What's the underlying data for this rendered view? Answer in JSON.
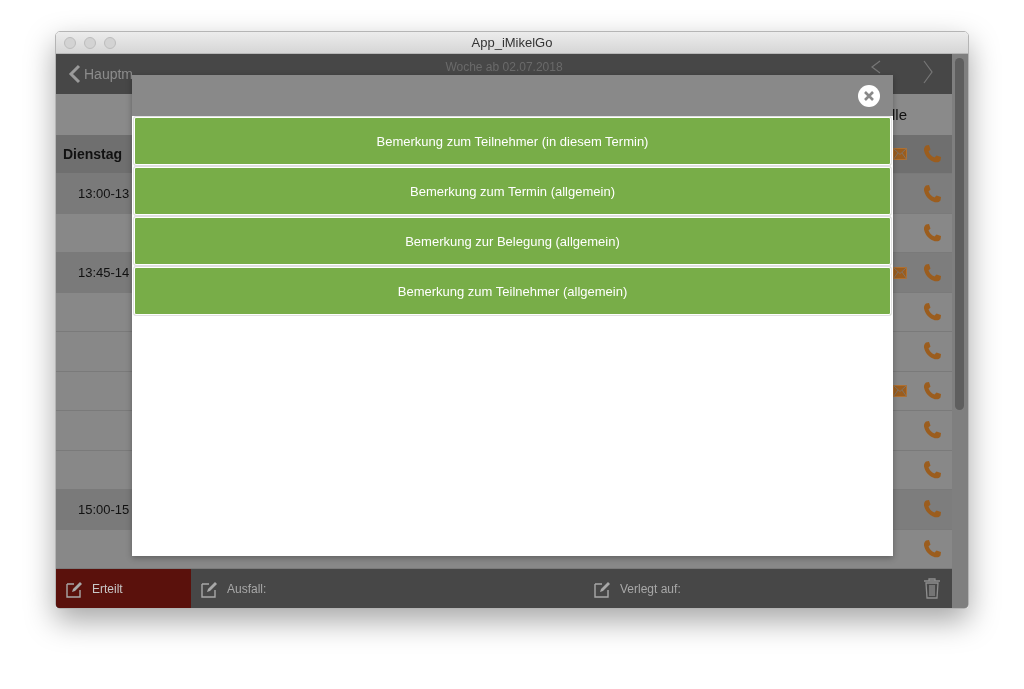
{
  "window": {
    "title": "App_iMikelGo"
  },
  "header": {
    "back_label": "Hauptm",
    "title": "Woche ab 02.07.2018"
  },
  "column_header": "lle",
  "rows": [
    {
      "kind": "day",
      "label": "Dienstag",
      "mail": true
    },
    {
      "kind": "time",
      "label": "13:00-13",
      "mail": false
    },
    {
      "kind": "empty",
      "mail": false
    },
    {
      "kind": "time",
      "label": "13:45-14",
      "mail": true
    },
    {
      "kind": "empty",
      "mail": false
    },
    {
      "kind": "empty",
      "mail": false
    },
    {
      "kind": "empty",
      "mail": true
    },
    {
      "kind": "empty",
      "mail": false
    },
    {
      "kind": "empty",
      "mail": false
    },
    {
      "kind": "time",
      "label": "15:00-15",
      "mail": false
    },
    {
      "kind": "empty",
      "mail": false
    }
  ],
  "bottom_bar": {
    "items": [
      {
        "label": "Erteilt",
        "selected": true
      },
      {
        "label": "Ausfall:",
        "selected": false
      },
      {
        "label": "Verlegt auf:",
        "selected": false
      }
    ]
  },
  "modal": {
    "buttons": [
      "Bemerkung zum Teilnehmer (in diesem Termin)",
      "Bemerkung zum Termin (allgemein)",
      "Bemerkung zur Belegung (allgemein)",
      "Bemerkung zum Teilnehmer (allgemein)"
    ]
  }
}
